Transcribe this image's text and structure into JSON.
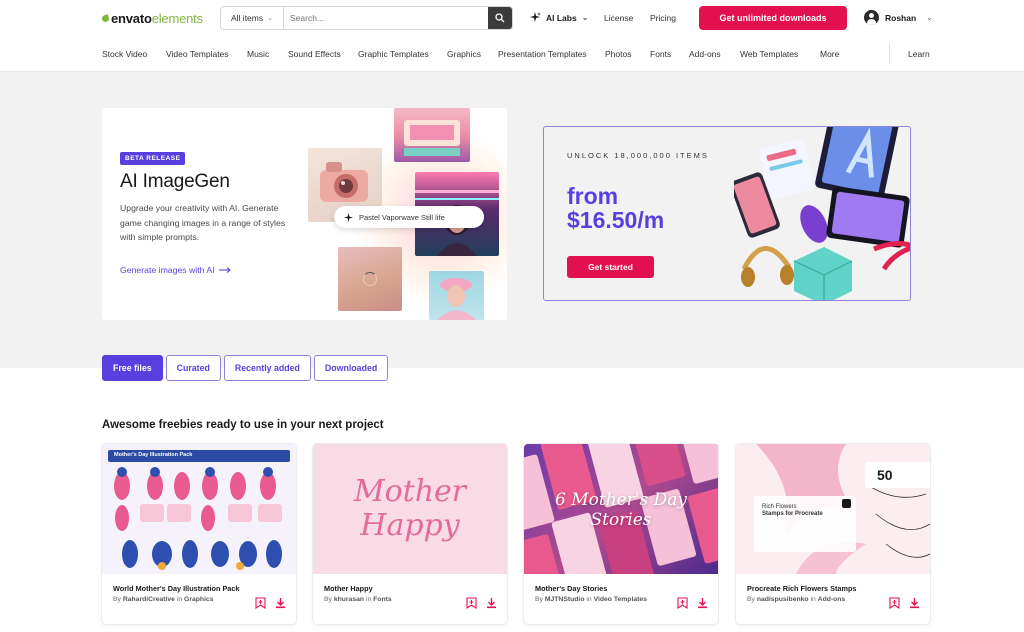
{
  "header": {
    "logo_bold": "envato",
    "logo_light": "elements",
    "search_category": "All items",
    "search_placeholder": "Search...",
    "ai_labs": "AI Labs",
    "license": "License",
    "pricing": "Pricing",
    "cta": "Get unlimited downloads",
    "user": "Roshan"
  },
  "nav": {
    "items": [
      "Stock Video",
      "Video Templates",
      "Music",
      "Sound Effects",
      "Graphic Templates",
      "Graphics",
      "Presentation Templates",
      "Photos",
      "Fonts",
      "Add-ons",
      "Web Templates",
      "More"
    ],
    "learn": "Learn"
  },
  "ai_card": {
    "badge": "BETA RELEASE",
    "title": "AI ImageGen",
    "description": "Upgrade your creativity with AI. Generate game changing images in a range of styles with simple prompts.",
    "link": "Generate images with AI",
    "prompt": "Pastel Vaporwave Still life"
  },
  "promo": {
    "label": "UNLOCK 18,000,000 ITEMS",
    "price_line1": "from",
    "price_line2": "$16.50/m",
    "button": "Get started"
  },
  "tabs": [
    "Free files",
    "Curated",
    "Recently added",
    "Downloaded"
  ],
  "section_title": "Awesome freebies ready to use in your next project",
  "cards": [
    {
      "title": "World Mother's Day Illustration Pack",
      "author": "RahardiCreative",
      "category": "Graphics",
      "thumb_header": "Mother's Day Illustration Pack"
    },
    {
      "title": "Mother Happy",
      "author": "khurasan",
      "category": "Fonts",
      "thumb_line1": "Mother",
      "thumb_line2": "Happy"
    },
    {
      "title": "Mother's Day Stories",
      "author": "MJTNStudio",
      "category": "Video Templates",
      "thumb_line1": "6 Mother's Day",
      "thumb_line2": "Stories"
    },
    {
      "title": "Procreate Rich Flowers Stamps",
      "author": "nadispusibenko",
      "category": "Add-ons",
      "thumb_count": "50",
      "thumb_label1": "Rich Flowers",
      "thumb_label2": "Stamps for Procreate"
    }
  ],
  "by_word": "By",
  "in_word": "in",
  "colors": {
    "accent": "#5a3fe0",
    "cta": "#e2104f",
    "brand_green": "#82b541"
  }
}
